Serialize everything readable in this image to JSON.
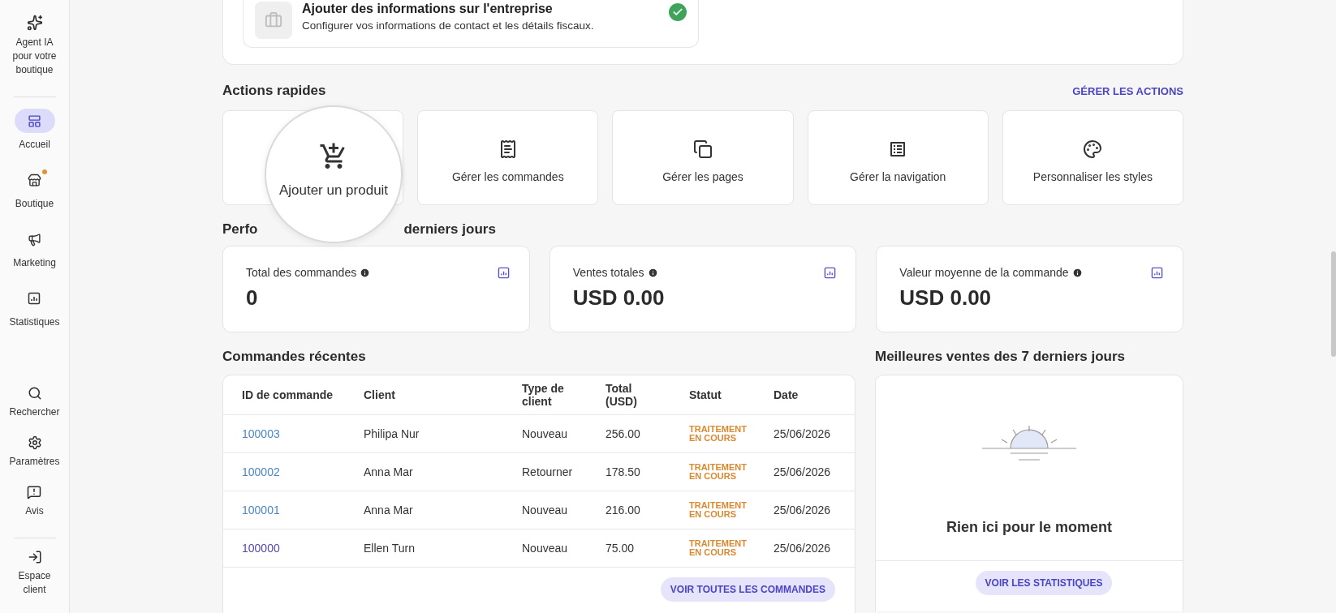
{
  "sidebar": {
    "top": {
      "label": "Agent IA pour votre boutique"
    },
    "nav": [
      {
        "label": "Accueil",
        "selected": true,
        "notification": false
      },
      {
        "label": "Boutique",
        "selected": false,
        "notification": true
      },
      {
        "label": "Marketing",
        "selected": false,
        "notification": false
      },
      {
        "label": "Statistiques",
        "selected": false,
        "notification": false
      }
    ],
    "bottom": [
      {
        "label": "Rechercher"
      },
      {
        "label": "Paramètres"
      },
      {
        "label": "Avis"
      }
    ],
    "footer": {
      "label": "Espace client"
    }
  },
  "setup_card": {
    "title": "Ajouter des informations sur l'entreprise",
    "description": "Configurer vos informations de contact et les détails fiscaux.",
    "done": true
  },
  "quick_actions": {
    "title": "Actions rapides",
    "manage_link": "GÉRER LES ACTIONS",
    "items": [
      {
        "label": "Ajouter un produit",
        "magnified": true
      },
      {
        "label": "Gérer les commandes",
        "magnified": false
      },
      {
        "label": "Gérer les pages",
        "magnified": false
      },
      {
        "label": "Gérer la navigation",
        "magnified": false
      },
      {
        "label": "Personnaliser les styles",
        "magnified": false
      }
    ]
  },
  "performance": {
    "title_parts": [
      "Perfo",
      "derniers jours"
    ],
    "cards": [
      {
        "label": "Total des commandes",
        "value": "0"
      },
      {
        "label": "Ventes totales",
        "value": "USD 0.00"
      },
      {
        "label": "Valeur moyenne de la commande",
        "value": "USD 0.00"
      }
    ]
  },
  "recent_orders": {
    "title": "Commandes récentes",
    "columns": [
      "ID de commande",
      "Client",
      "Type de client",
      "Total (USD)",
      "Statut",
      "Date"
    ],
    "rows": [
      {
        "id": "100003",
        "visited": false,
        "client": "Philipa Nur",
        "client_type": "Nouveau",
        "total": "256.00",
        "status": {
          "label": "TRAITEMENT EN COURS",
          "kind": "processing"
        },
        "date": "25/06/2026"
      },
      {
        "id": "100002",
        "visited": false,
        "client": "Anna Mar",
        "client_type": "Retourner",
        "total": "178.50",
        "status": {
          "label": "TRAITEMENT EN COURS",
          "kind": "processing"
        },
        "date": "25/06/2026"
      },
      {
        "id": "100001",
        "visited": false,
        "client": "Anna Mar",
        "client_type": "Nouveau",
        "total": "216.00",
        "status": {
          "label": "TRAITEMENT EN COURS",
          "kind": "processing"
        },
        "date": "25/06/2026"
      },
      {
        "id": "100000",
        "visited": true,
        "client": "Ellen Turn",
        "client_type": "Nouveau",
        "total": "75.00",
        "status": {
          "label": "TRAITEMENT EN COURS",
          "kind": "processing"
        },
        "date": "25/06/2026"
      }
    ],
    "button": "VOIR TOUTES LES COMMANDES"
  },
  "best_sellers": {
    "title": "Meilleures ventes des 7 derniers jours",
    "empty_text": "Rien ici pour le moment",
    "button": "VOIR LES STATISTIQUES"
  }
}
